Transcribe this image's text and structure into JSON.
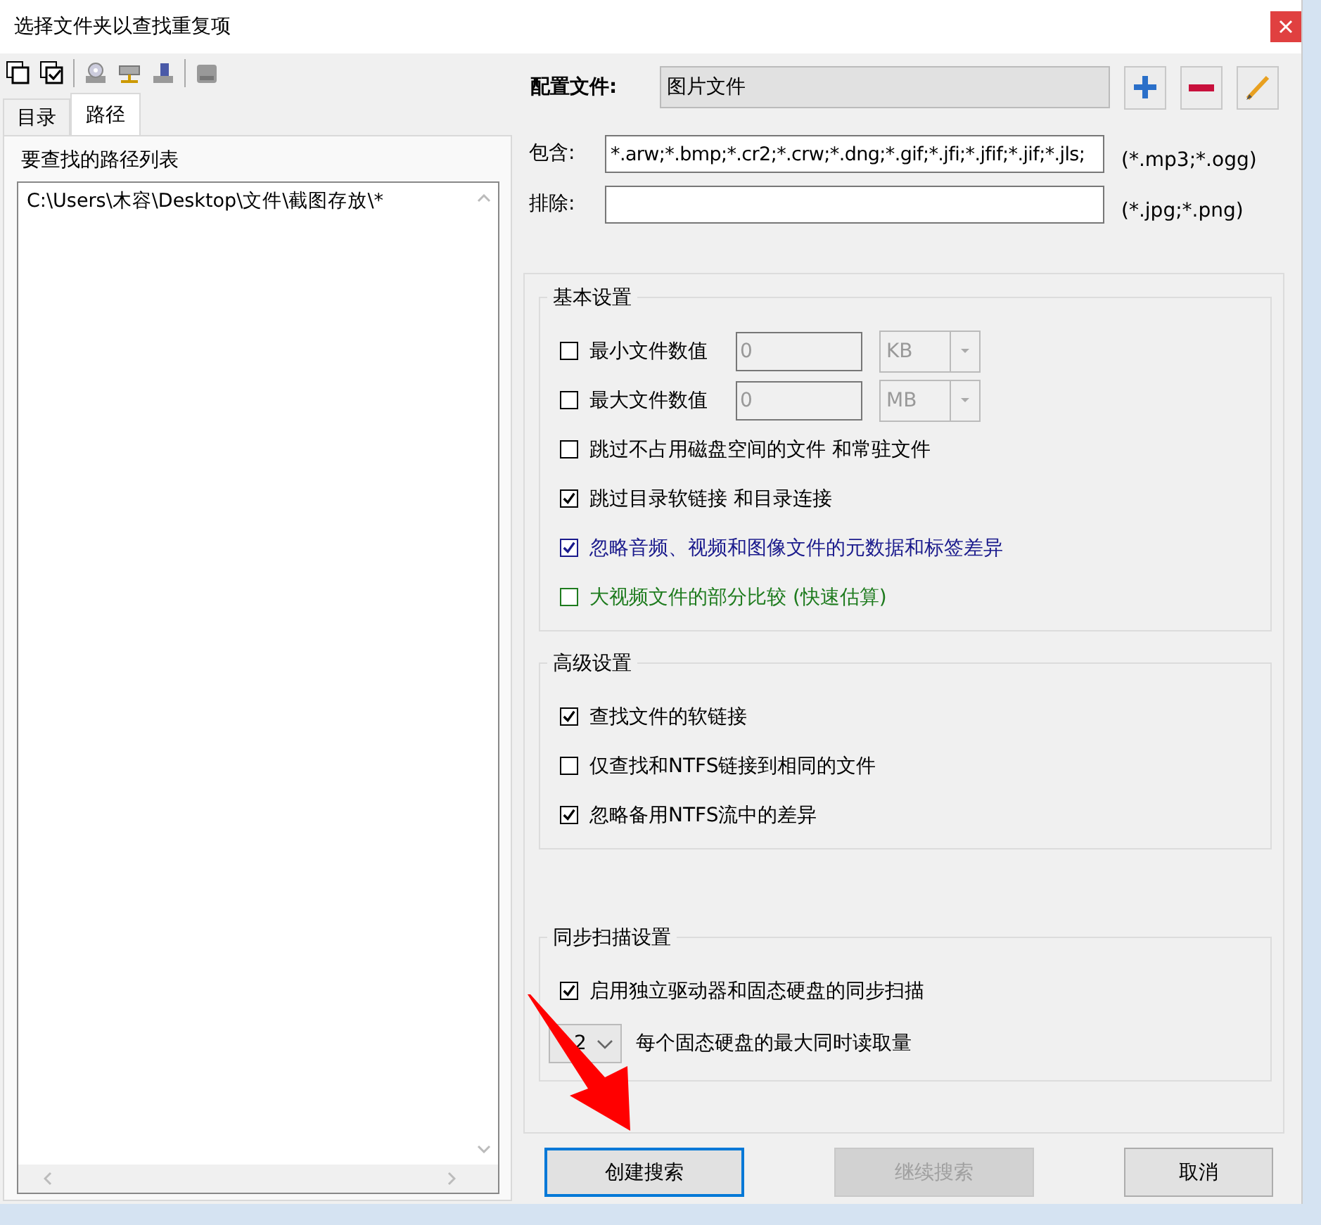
{
  "window": {
    "title": "选择文件夹以查找重复项"
  },
  "left_panel": {
    "tabs": [
      {
        "label": "目录",
        "selected": false
      },
      {
        "label": "路径",
        "selected": true
      }
    ],
    "list_title": "要查找的路径列表",
    "paths": [
      "C:\\Users\\木容\\Desktop\\文件\\截图存放\\*"
    ]
  },
  "profile": {
    "label": "配置文件:",
    "value": "图片文件"
  },
  "filters": [
    {
      "label": "包含:",
      "value": "*.arw;*.bmp;*.cr2;*.crw;*.dng;*.gif;*.jfi;*.jfif;*.jif;*.jls;",
      "hint": "(*.mp3;*.ogg)"
    },
    {
      "label": "排除:",
      "hint": "(*.jpg;*.png)"
    }
  ],
  "groups": [
    {
      "title": "基本设置",
      "items": [
        {
          "kind": "size",
          "label": "最小文件数值",
          "checked": false,
          "value": "0",
          "unit": "KB",
          "disabled": true
        },
        {
          "kind": "size",
          "label": "最大文件数值",
          "checked": false,
          "value": "0",
          "unit": "MB",
          "disabled": true
        },
        {
          "kind": "check",
          "label": "跳过不占用磁盘空间的文件 和常驻文件",
          "checked": false,
          "color": "#000000"
        },
        {
          "kind": "check",
          "label": "跳过目录软链接 和目录连接",
          "checked": true,
          "color": "#000000"
        },
        {
          "kind": "check",
          "label": "忽略音频、视频和图像文件的元数据和标签差异",
          "checked": true,
          "color": "#1a1a8c"
        },
        {
          "kind": "check",
          "label": "大视频文件的部分比较 (快速估算)",
          "checked": false,
          "color": "#1e7b1e"
        }
      ]
    },
    {
      "title": "高级设置",
      "items": [
        {
          "kind": "check",
          "label": "查找文件的软链接",
          "checked": true,
          "color": "#000000"
        },
        {
          "kind": "check",
          "label": "仅查找和NTFS链接到相同的文件",
          "checked": false,
          "color": "#000000"
        },
        {
          "kind": "check",
          "label": "忽略备用NTFS流中的差异",
          "checked": true,
          "color": "#000000"
        }
      ]
    },
    {
      "title": "同步扫描设置",
      "items": [
        {
          "kind": "check",
          "label": "启用独立驱动器和固态硬盘的同步扫描",
          "checked": true,
          "color": "#000000"
        },
        {
          "kind": "select",
          "value": "2",
          "label": "每个固态硬盘的最大同时读取量"
        }
      ]
    }
  ],
  "buttons": [
    {
      "label": "创建搜索",
      "disabled": false,
      "focused": true
    },
    {
      "label": "继续搜索",
      "disabled": true,
      "focused": false
    },
    {
      "label": "取消",
      "disabled": false,
      "focused": false
    }
  ]
}
